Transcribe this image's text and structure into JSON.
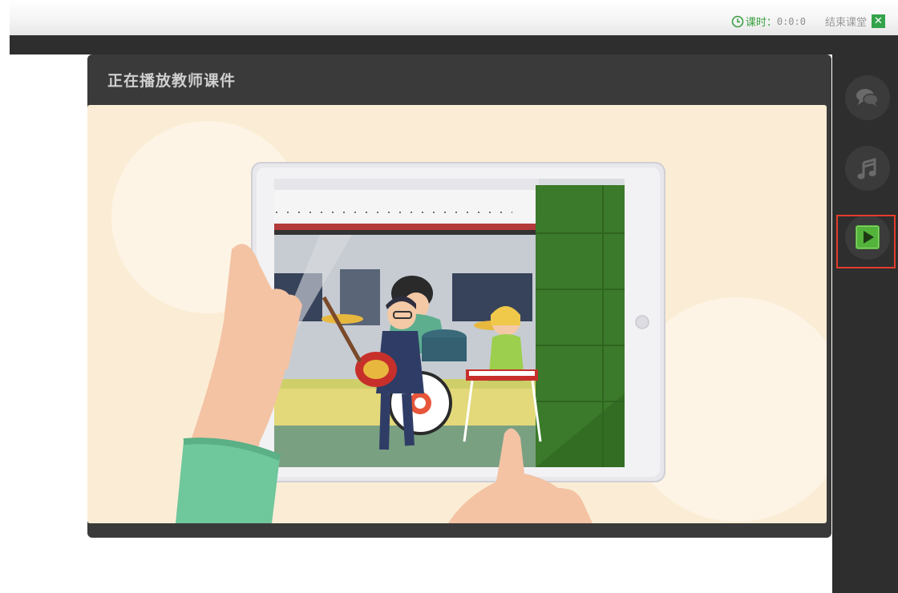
{
  "topbar": {
    "timer_label": "课时：",
    "timer_value": "0:0:0",
    "end_class_label": "结束课堂",
    "close_glyph": "✕"
  },
  "panel": {
    "title": "正在播放教师课件"
  },
  "sidebar": {
    "items": [
      {
        "name": "chat",
        "icon": "chat-bubbles-icon"
      },
      {
        "name": "music",
        "icon": "music-note-icon"
      },
      {
        "name": "play",
        "icon": "play-icon",
        "active": true
      }
    ]
  },
  "colors": {
    "accent_green": "#33a34a",
    "highlight_red": "#e53c2c",
    "panel_dark": "#2e2e2e",
    "stage_bg": "#fbedd5"
  }
}
